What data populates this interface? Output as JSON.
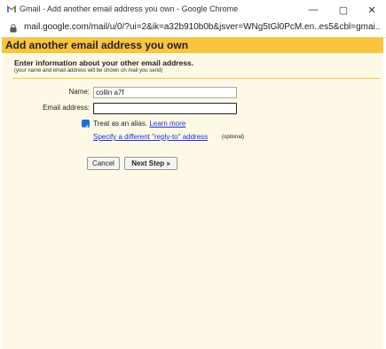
{
  "window": {
    "title": "Gmail - Add another email address you own - Google Chrome",
    "minimize_glyph": "—",
    "maximize_glyph": "▢",
    "close_glyph": "✕"
  },
  "address_bar": {
    "url": "mail.google.com/mail/u/0/?ui=2&ik=a32b910b0b&jsver=WNg5tGl0PcM.en..es5&cbl=gmai..."
  },
  "page": {
    "title": "Add another email address you own",
    "section_title": "Enter information about your other email address.",
    "section_subtitle": "(your name and email address will be shown on mail you send)"
  },
  "form": {
    "name_label": "Name:",
    "name_value": "collin a7f",
    "email_label": "Email address:",
    "email_value": "",
    "alias_checked": true,
    "alias_text": "Treat as an alias.",
    "learn_more": "Learn more",
    "reply_to_link": "Specify a different \"reply-to\" address",
    "optional_text": "(optional)"
  },
  "buttons": {
    "cancel": "Cancel",
    "next_step": "Next Step »"
  },
  "colors": {
    "header_band": "#f9c541",
    "content_background": "#fef9e6",
    "link": "#1f2fe0",
    "checkbox": "#1a6fe0"
  },
  "icons": {
    "tab_icon": "gmail-logo-icon",
    "security": "lock-icon",
    "alias_checkbox": "checkmark-icon"
  }
}
